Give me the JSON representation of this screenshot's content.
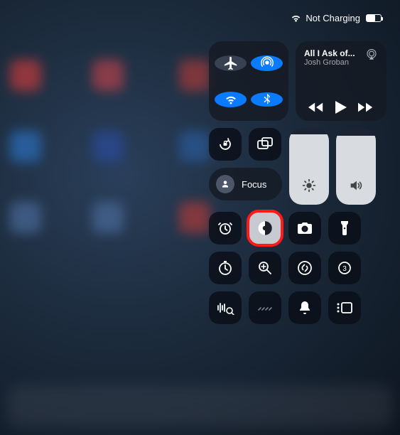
{
  "status": {
    "charging_text": "Not Charging"
  },
  "media": {
    "title": "All I Ask of...",
    "artist": "Josh Groban"
  },
  "focus": {
    "label": "Focus"
  },
  "sliders": {
    "brightness_percent": 92,
    "volume_percent": 90
  },
  "badge": {
    "count": "3"
  }
}
